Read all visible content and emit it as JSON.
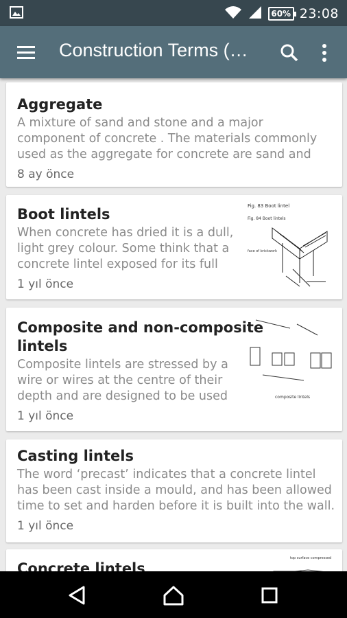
{
  "status_bar": {
    "time": "23:08",
    "battery": "60%"
  },
  "app_bar": {
    "title": "Construction Terms (…"
  },
  "cards": [
    {
      "title": "Aggregate",
      "desc_lines": [
        "A mixture of sand and stone and a major",
        "component of concrete . The materials commonly",
        "used as the aggregate for concrete are sand and"
      ],
      "time": "8 ay önce"
    },
    {
      "title": "Boot lintels",
      "desc_lines": [
        "When concrete has dried it is a dull,",
        "light grey colour. Some think that a",
        "concrete lintel exposed for its full"
      ],
      "time": "1 yıl önce"
    },
    {
      "title_lines": [
        "Composite and non-composite",
        "lintels"
      ],
      "desc_lines": [
        "Composite lintels are stressed by a",
        "wire or wires at the centre of their",
        "depth and are designed to be used"
      ],
      "time": "1 yıl önce"
    },
    {
      "title": "Casting lintels",
      "desc_lines": [
        "The word ‘precast’ indicates that a concrete lintel",
        "has been cast inside a mould, and has been allowed",
        "time to set and harden before it is built into the wall."
      ],
      "time": "1 yıl önce"
    },
    {
      "title": "Concrete lintels"
    }
  ],
  "thumb_labels": {
    "boot_fig83": "Fig. 83 Boot lintel",
    "boot_fig84": "Fig. 84 Boot lintels",
    "boot_face": "face of brickwork",
    "comp_caption": "composite lintels",
    "last_caption": "top surface compressed"
  }
}
